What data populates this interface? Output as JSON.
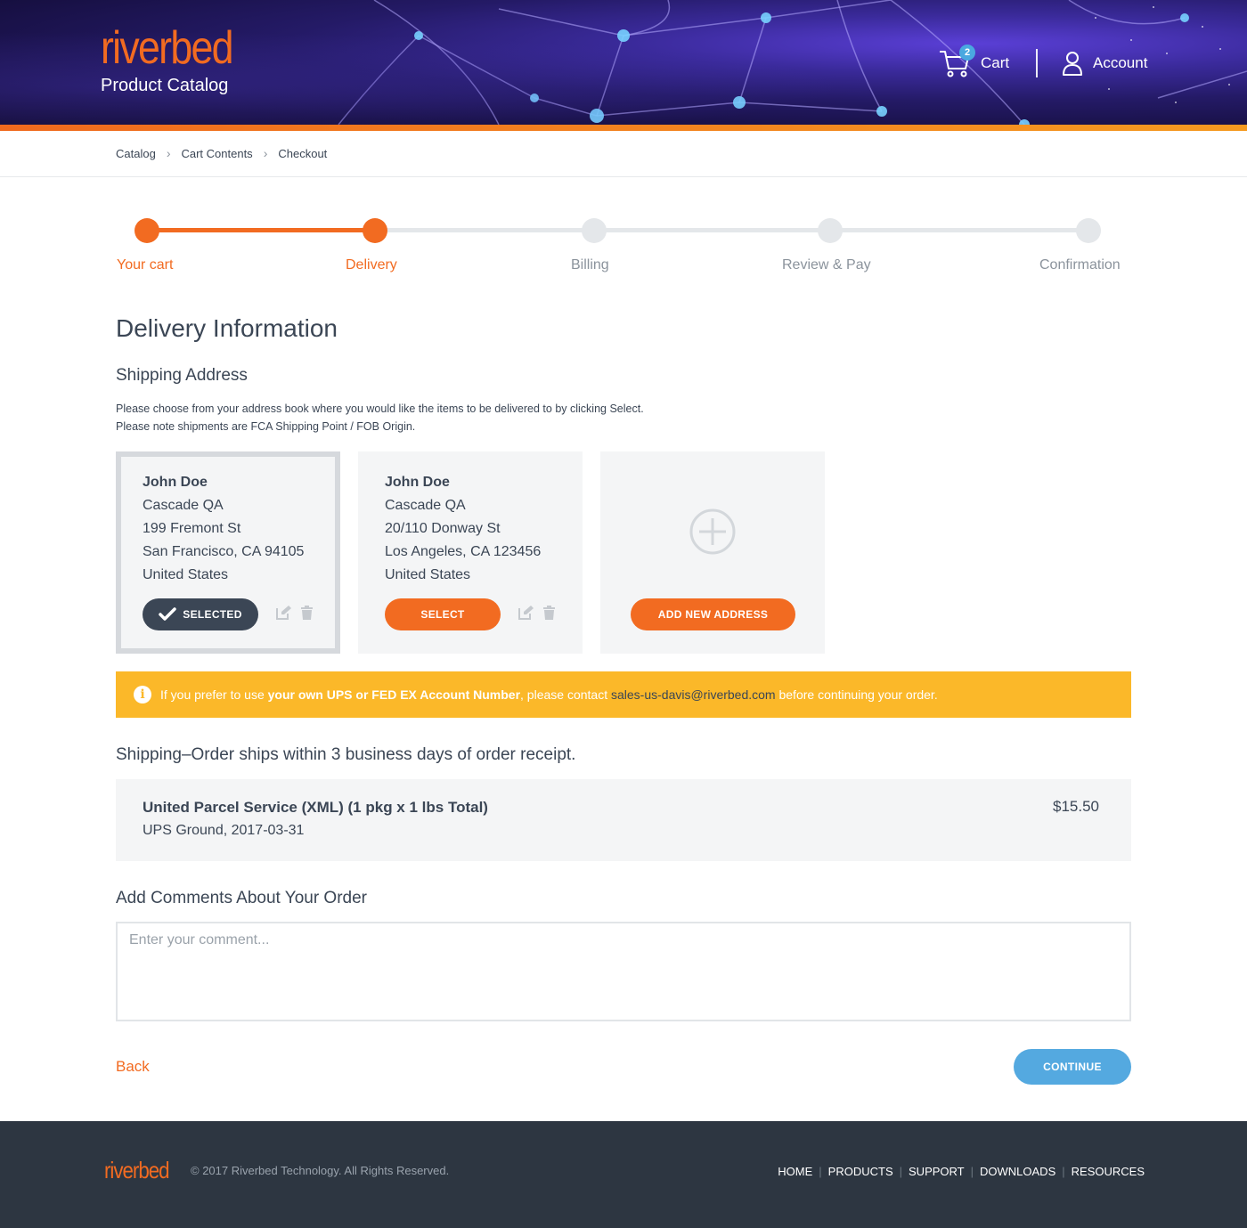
{
  "header": {
    "logo": "riverbed",
    "subtitle": "Product Catalog",
    "cart_label": "Cart",
    "cart_count": "2",
    "account_label": "Account"
  },
  "breadcrumb": [
    "Catalog",
    "Cart Contents",
    "Checkout"
  ],
  "steps": [
    {
      "label": "Your cart",
      "state": "done"
    },
    {
      "label": "Delivery",
      "state": "active"
    },
    {
      "label": "Billing",
      "state": "pending"
    },
    {
      "label": "Review & Pay",
      "state": "pending"
    },
    {
      "label": "Confirmation",
      "state": "pending"
    }
  ],
  "page_title": "Delivery Information",
  "shipping_address": {
    "heading": "Shipping Address",
    "hint_line1": "Please choose from your address book where you would like the items to be delivered to by clicking Select.",
    "hint_line2": "Please note shipments are FCA Shipping Point / FOB Origin.",
    "addresses": [
      {
        "name": "John Doe",
        "company": "Cascade QA",
        "street": "199 Fremont St",
        "city": "San Francisco, CA 94105",
        "country": "United States",
        "button": "SELECTED",
        "selected": true
      },
      {
        "name": "John Doe",
        "company": "Cascade QA",
        "street": "20/110 Donway St",
        "city": "Los Angeles, CA 123456",
        "country": "United States",
        "button": "SELECT",
        "selected": false
      }
    ],
    "add_button": "ADD NEW ADDRESS"
  },
  "notice": {
    "pre": "If you prefer to use ",
    "bold": "your own UPS or FED EX Account Number",
    "mid": ", please contact ",
    "email": "sales-us-davis@riverbed.com",
    "post": " before continuing your order."
  },
  "shipping": {
    "heading": "Shipping–Order ships within 3 business days of order receipt.",
    "method": "United Parcel Service (XML) (1 pkg x 1 lbs Total)",
    "detail": "UPS Ground, 2017-03-31",
    "price": "$15.50"
  },
  "comments": {
    "heading": "Add Comments About Your Order",
    "placeholder": "Enter your comment..."
  },
  "actions": {
    "back": "Back",
    "continue": "CONTINUE"
  },
  "footer": {
    "logo": "riverbed",
    "copyright": "© 2017 Riverbed Technology. All Rights Reserved.",
    "nav": [
      "HOME",
      "PRODUCTS",
      "SUPPORT",
      "DOWNLOADS",
      "RESOURCES"
    ]
  },
  "colors": {
    "accent": "#f26b21",
    "dark": "#3b4655",
    "notice": "#fbb829",
    "primary_button": "#54a9e0",
    "footer": "#2d3641"
  }
}
